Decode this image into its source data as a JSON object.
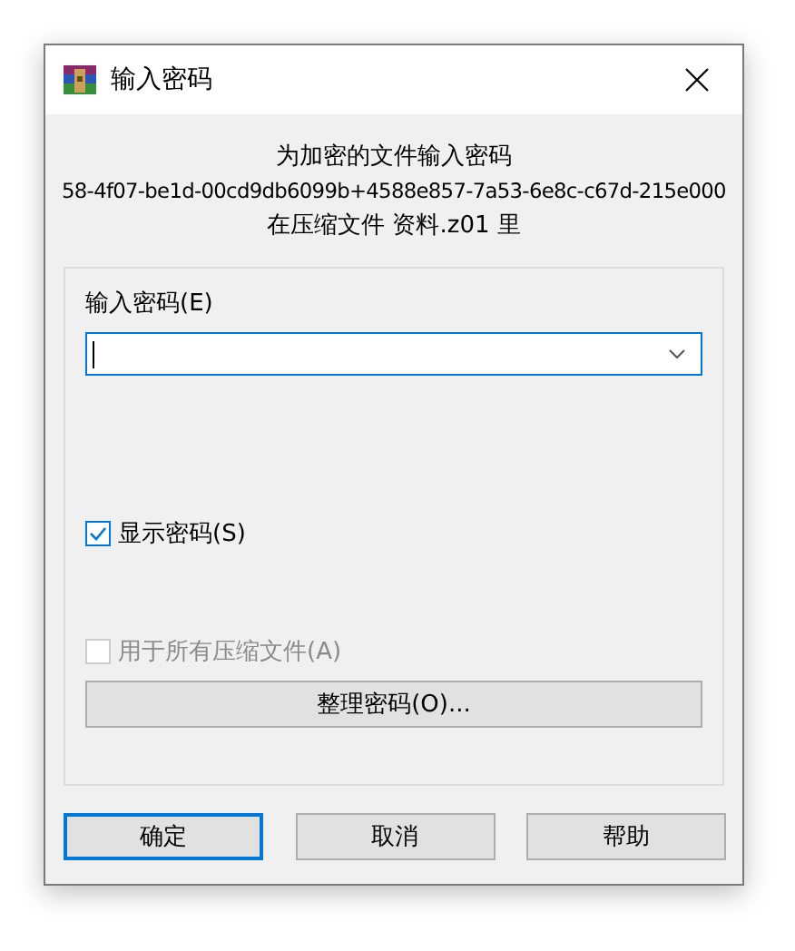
{
  "window": {
    "title": "输入密码"
  },
  "prompt": {
    "heading": "为加密的文件输入密码",
    "file_path": "58-4f07-be1d-00cd9db6099b+4588e857-7a53-6e8c-c67d-215e000",
    "archive_line": "在压缩文件 资料.z01 里"
  },
  "password": {
    "label": "输入密码(E)",
    "focused": true
  },
  "checkboxes": [
    {
      "label": "显示密码(S)",
      "checked": true,
      "disabled": false,
      "kind": "upper"
    },
    {
      "label": "用于所有压缩文件(A)",
      "checked": false,
      "disabled": true,
      "kind": "lower"
    }
  ],
  "organize_button": "整理密码(O)...",
  "buttons": [
    {
      "label": "确定",
      "default": true
    },
    {
      "label": "取消",
      "default": false
    },
    {
      "label": "帮助",
      "default": false
    }
  ]
}
